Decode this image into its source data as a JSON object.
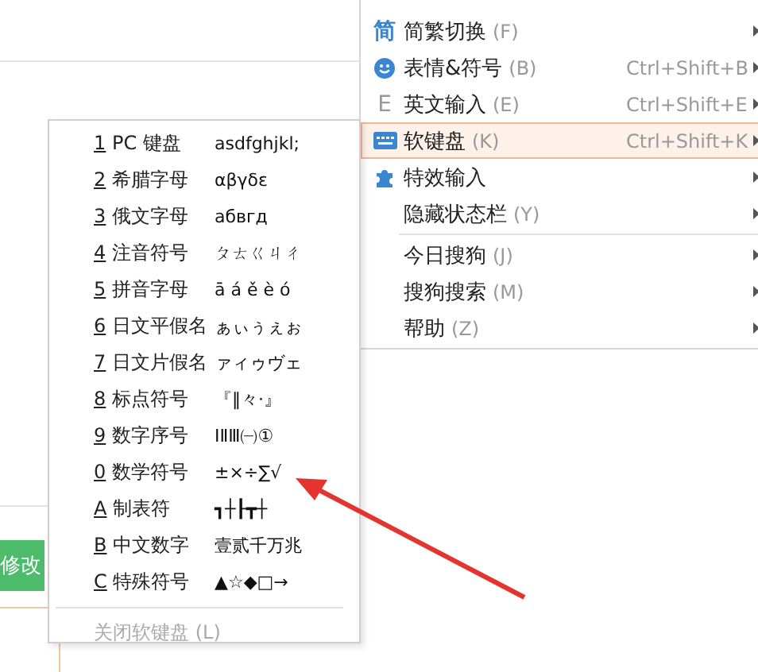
{
  "edit_button": {
    "label": "修改"
  },
  "main_menu": {
    "items": [
      {
        "kind": "glyph",
        "icon_text": "简",
        "label": "简繁切换",
        "key": "(F)",
        "selected": false
      },
      {
        "kind": "smiley",
        "label": "表情&符号",
        "key": "(B)",
        "shortcut": "Ctrl+Shift+B",
        "selected": false
      },
      {
        "kind": "glyph",
        "icon_text": "E",
        "label": "英文输入",
        "key": "(E)",
        "shortcut": "Ctrl+Shift+E",
        "selected": false
      },
      {
        "kind": "keyboard",
        "label": "软键盘",
        "key": "(K)",
        "shortcut": "Ctrl+Shift+K",
        "selected": true
      },
      {
        "kind": "puzzle",
        "label": "特效输入",
        "selected": false
      },
      {
        "kind": "none",
        "label": "隐藏状态栏",
        "key": "(Y)",
        "selected": false
      },
      {
        "kind": "separator"
      },
      {
        "kind": "none",
        "label": "今日搜狗",
        "key": "(J)",
        "selected": false
      },
      {
        "kind": "none",
        "label": "搜狗搜索",
        "key": "(M)",
        "selected": false
      },
      {
        "kind": "none",
        "label": "帮助",
        "key": "(Z)",
        "selected": false
      }
    ]
  },
  "keyboard_menu": {
    "items": [
      {
        "mnemonic": "1",
        "label": "PC 键盘",
        "sample": "asdfghjkl;"
      },
      {
        "mnemonic": "2",
        "label": "希腊字母",
        "sample": "αβγδε"
      },
      {
        "mnemonic": "3",
        "label": "俄文字母",
        "sample": "абвгд"
      },
      {
        "mnemonic": "4",
        "label": "注音符号",
        "sample": "ㄆㄊㄍㄐㄔ"
      },
      {
        "mnemonic": "5",
        "label": "拼音字母",
        "sample": "ā á ě è ó"
      },
      {
        "mnemonic": "6",
        "label": "日文平假名",
        "sample": "ぁぃぅぇぉ"
      },
      {
        "mnemonic": "7",
        "label": "日文片假名",
        "sample": "ァィゥヴェ"
      },
      {
        "mnemonic": "8",
        "label": "标点符号",
        "sample": "『‖々·』"
      },
      {
        "mnemonic": "9",
        "label": "数字序号",
        "sample": "ⅠⅡⅢ㈠①"
      },
      {
        "mnemonic": "0",
        "label": "数学符号",
        "sample": "±×÷∑√"
      },
      {
        "mnemonic": "A",
        "label": "制表符",
        "sample": "┓┼┠┳┼"
      },
      {
        "mnemonic": "B",
        "label": "中文数字",
        "sample": "壹贰千万兆"
      },
      {
        "mnemonic": "C",
        "label": "特殊符号",
        "sample": "▲☆◆□→"
      }
    ],
    "close_item": {
      "label": "关闭软键盘",
      "key": "(L)",
      "disabled": true
    }
  }
}
